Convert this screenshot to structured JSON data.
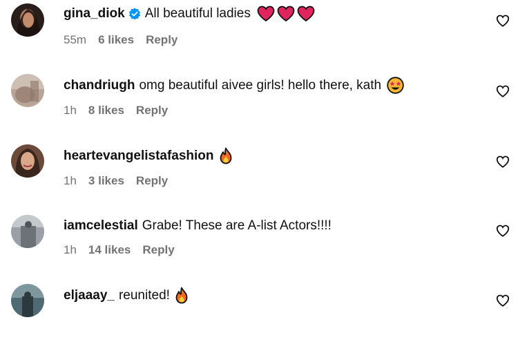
{
  "comments": [
    {
      "username": "gina_diok",
      "verified": true,
      "text": "All beautiful ladies",
      "emojis": [
        "red-heart",
        "red-heart",
        "red-heart"
      ],
      "time": "55m",
      "likes": "6 likes",
      "reply": "Reply"
    },
    {
      "username": "chandriugh",
      "verified": false,
      "text": "omg beautiful aivee girls! hello there, kath",
      "emojis": [
        "star-struck"
      ],
      "time": "1h",
      "likes": "8 likes",
      "reply": "Reply"
    },
    {
      "username": "heartevangelistafashion",
      "verified": false,
      "text": "",
      "emojis": [
        "fire"
      ],
      "time": "1h",
      "likes": "3 likes",
      "reply": "Reply"
    },
    {
      "username": "iamcelestial",
      "verified": false,
      "text": "Grabe! These are A-list Actors!!!!",
      "emojis": [],
      "time": "1h",
      "likes": "14 likes",
      "reply": "Reply"
    },
    {
      "username": "eljaaay_",
      "verified": false,
      "text": "reunited!",
      "emojis": [
        "fire"
      ],
      "time": "",
      "likes": "",
      "reply": ""
    }
  ],
  "colors": {
    "verified": "#0095f6",
    "heart": "#e0245e",
    "meta": "#737373"
  }
}
